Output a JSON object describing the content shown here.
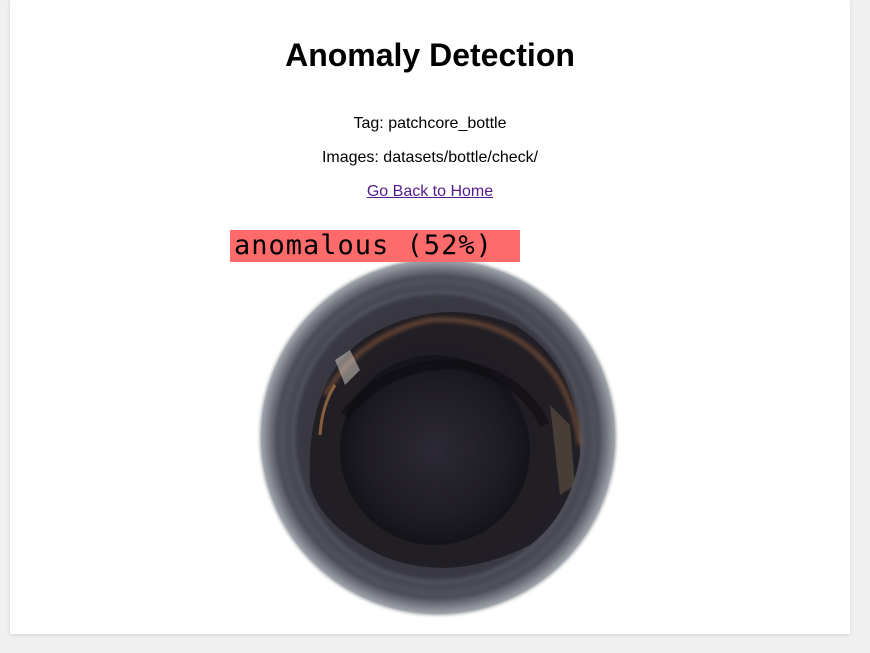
{
  "page": {
    "title": "Anomaly Detection",
    "tag_text": "Tag: patchcore_bottle",
    "images_text": "Images: datasets/bottle/check/",
    "home_link_label": "Go Back to Home"
  },
  "result": {
    "label": "anomalous (52%)",
    "label_color": "#ff6b6b",
    "image_subject": "bottle-top-view"
  },
  "colors": {
    "background": "#f0f0f0",
    "card": "#ffffff",
    "link_visited": "#551a8b"
  }
}
